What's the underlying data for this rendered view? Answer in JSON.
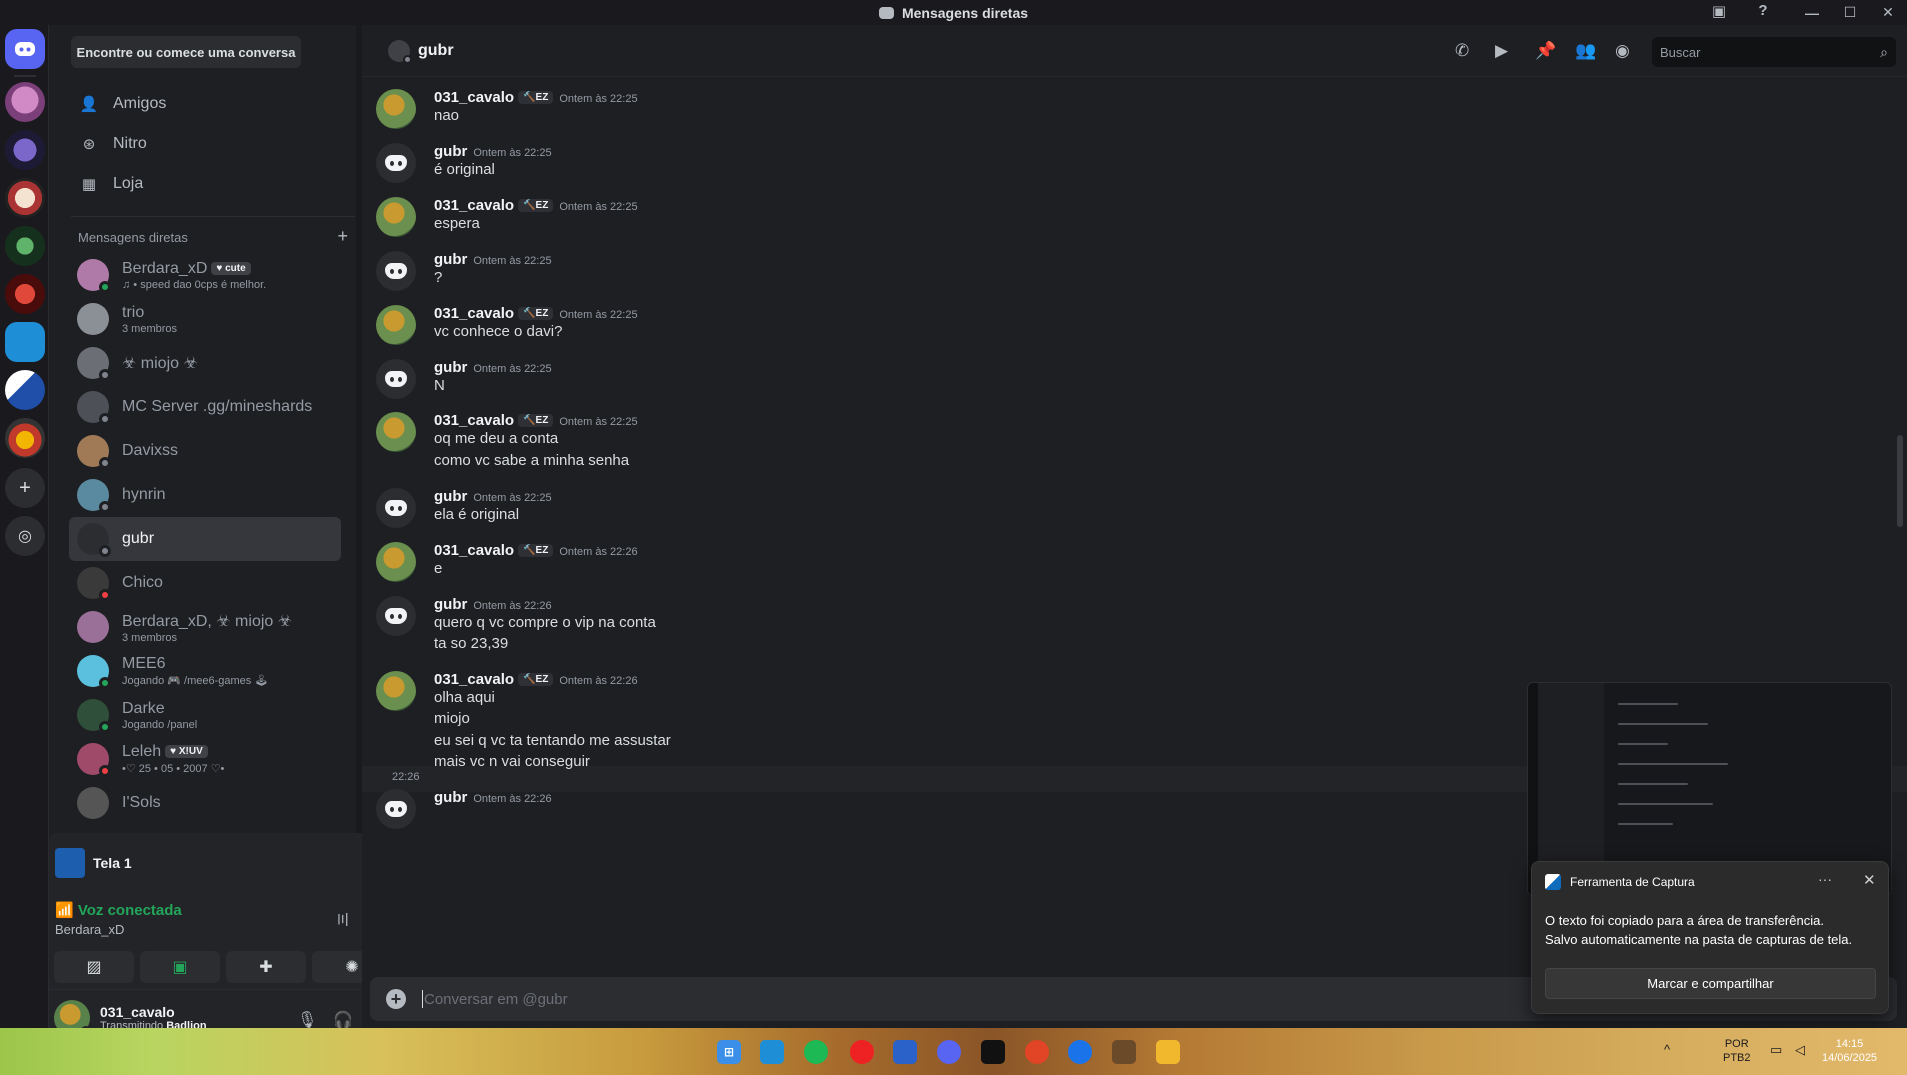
{
  "window": {
    "title": "Mensagens diretas",
    "controls": [
      "—",
      "☐",
      "✕"
    ]
  },
  "sidebar": {
    "find_label": "Encontre ou comece uma conversa",
    "nav": [
      {
        "label": "Amigos",
        "icon": "friends-icon"
      },
      {
        "label": "Nitro",
        "icon": "nitro-icon"
      },
      {
        "label": "Loja",
        "icon": "shop-icon"
      }
    ],
    "dm_header": "Mensagens diretas",
    "dms": [
      {
        "name": "Berdara_xD",
        "tag": "♥ cute",
        "sub": "♫ • speed dao 0cps é melhor.",
        "status": "online",
        "avatar_color": "#b07aa8"
      },
      {
        "name": "trio",
        "sub": "3 membros",
        "avatar_color": "#8b8f96"
      },
      {
        "name": "☣ miojo ☣",
        "status": "offline",
        "avatar_color": "#6b6e75"
      },
      {
        "name": "MC Server .gg/mineshards",
        "status": "offline",
        "avatar_color": "#4e5058"
      },
      {
        "name": "Davixss",
        "status": "offline",
        "avatar_color": "#a07a56"
      },
      {
        "name": "hynrin",
        "status": "offline",
        "avatar_color": "#5a8aa0"
      },
      {
        "name": "gubr",
        "status": "offline",
        "active": true,
        "avatar_color": "#2b2d31"
      },
      {
        "name": "Chico",
        "status": "dnd",
        "avatar_color": "#3a3a3a"
      },
      {
        "name": "Berdara_xD, ☣ miojo ☣",
        "sub": "3 membros",
        "avatar_color": "#9a6f98"
      },
      {
        "name": "MEE6",
        "sub": "Jogando 🎮 /mee6-games 🕹",
        "status": "online",
        "avatar_color": "#5bc0de"
      },
      {
        "name": "Darke",
        "sub": "Jogando /panel",
        "status": "online",
        "avatar_color": "#2f4f3a"
      },
      {
        "name": "Leleh",
        "tag": "♥ X!UV",
        "sub": "•♡ 25 • 05 • 2007 ♡•",
        "status": "dnd",
        "avatar_color": "#a04a6a"
      },
      {
        "name": "I'Sols",
        "avatar_color": "#555"
      }
    ]
  },
  "screenshare": {
    "title": "Tela 1"
  },
  "voice": {
    "status": "Voz conectada",
    "channel": "Berdara_xD"
  },
  "user": {
    "name": "031_cavalo",
    "activity_prefix": "Transmitindo",
    "activity_game": "Badlion"
  },
  "chat": {
    "recipient": "gubr",
    "search_placeholder": "Buscar",
    "composer_placeholder": "Conversar em @gubr",
    "hover_time": "22:26",
    "messages": [
      {
        "author": "031_cavalo",
        "tag": "🔨EZ",
        "time": "Ontem às 22:25",
        "lines": [
          "nao"
        ]
      },
      {
        "author": "gubr",
        "time": "Ontem às 22:25",
        "lines": [
          "é original"
        ]
      },
      {
        "author": "031_cavalo",
        "tag": "🔨EZ",
        "time": "Ontem às 22:25",
        "lines": [
          "espera"
        ]
      },
      {
        "author": "gubr",
        "time": "Ontem às 22:25",
        "lines": [
          "?"
        ]
      },
      {
        "author": "031_cavalo",
        "tag": "🔨EZ",
        "time": "Ontem às 22:25",
        "lines": [
          "vc conhece o davi?"
        ]
      },
      {
        "author": "gubr",
        "time": "Ontem às 22:25",
        "lines": [
          "N"
        ]
      },
      {
        "author": "031_cavalo",
        "tag": "🔨EZ",
        "time": "Ontem às 22:25",
        "lines": [
          "oq me deu a conta",
          "como vc sabe a minha senha"
        ]
      },
      {
        "author": "gubr",
        "time": "Ontem às 22:25",
        "lines": [
          "ela é original"
        ]
      },
      {
        "author": "031_cavalo",
        "tag": "🔨EZ",
        "time": "Ontem às 22:26",
        "lines": [
          "e"
        ]
      },
      {
        "author": "gubr",
        "time": "Ontem às 22:26",
        "lines": [
          "quero q vc compre o vip na conta",
          "ta so 23,39"
        ]
      },
      {
        "author": "031_cavalo",
        "tag": "🔨EZ",
        "time": "Ontem às 22:26",
        "lines": [
          "olha aqui",
          "miojo",
          "eu sei q vc ta tentando me assustar",
          "mais vc n vai conseguir"
        ]
      },
      {
        "author": "gubr",
        "time": "Ontem às 22:26",
        "lines": [
          ""
        ]
      }
    ]
  },
  "toast": {
    "title": "Ferramenta de Captura",
    "more": "···",
    "body_1": "O texto foi copiado para a área de transferência.",
    "body_2": "Salvo automaticamente na pasta de capturas de tela.",
    "button": "Marcar e compartilhar"
  },
  "taskbar": {
    "lang_1": "POR",
    "lang_2": "PTB2",
    "time": "14:15",
    "date": "14/06/2025"
  }
}
